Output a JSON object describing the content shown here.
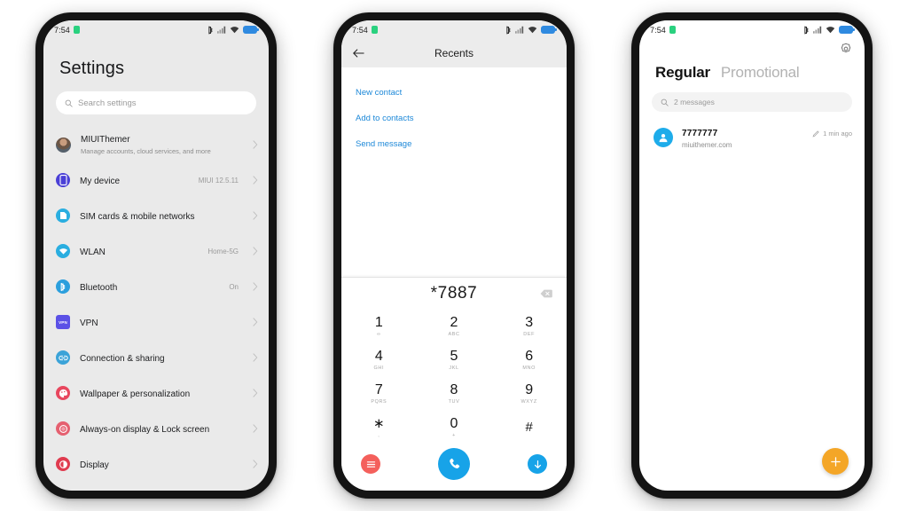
{
  "statusbar": {
    "time": "7:54",
    "icons": [
      "shield-green-icon",
      "bluetooth-icon",
      "signal-icon",
      "wifi-icon",
      "battery-icon"
    ]
  },
  "colors": {
    "accent_blue": "#1d88d8",
    "call_blue": "#17a3e8",
    "red": "#f4605c",
    "orange": "#f4a627",
    "avatar_blue": "#1eacea",
    "settings_bg": "#eaeaea",
    "battery_blue": "#2f8ae0",
    "green": "#2ad17f"
  },
  "settings": {
    "title": "Settings",
    "search_placeholder": "Search settings",
    "items": [
      {
        "label": "MIUIThemer",
        "sub": "Manage accounts, cloud services, and more",
        "value": "",
        "icon": "account-avatar"
      },
      {
        "label": "My device",
        "sub": "",
        "value": "MIUI 12.5.11",
        "icon": "device-icon"
      },
      {
        "label": "SIM cards & mobile networks",
        "sub": "",
        "value": "",
        "icon": "sim-card-icon"
      },
      {
        "label": "WLAN",
        "sub": "",
        "value": "Home-5G",
        "icon": "wifi-icon"
      },
      {
        "label": "Bluetooth",
        "sub": "",
        "value": "On",
        "icon": "bluetooth-icon"
      },
      {
        "label": "VPN",
        "sub": "",
        "value": "",
        "icon": "vpn-icon"
      },
      {
        "label": "Connection & sharing",
        "sub": "",
        "value": "",
        "icon": "link-icon"
      },
      {
        "label": "Wallpaper & personalization",
        "sub": "",
        "value": "",
        "icon": "palette-icon"
      },
      {
        "label": "Always-on display & Lock screen",
        "sub": "",
        "value": "",
        "icon": "aod-icon"
      },
      {
        "label": "Display",
        "sub": "",
        "value": "",
        "icon": "brightness-icon"
      }
    ]
  },
  "dialer": {
    "title": "Recents",
    "back_icon": "back-arrow-icon",
    "actions": [
      "New contact",
      "Add to contacts",
      "Send message"
    ],
    "number": "*7887",
    "backspace_icon": "backspace-icon",
    "keys": [
      {
        "digit": "1",
        "letters": "∞"
      },
      {
        "digit": "2",
        "letters": "ABC"
      },
      {
        "digit": "3",
        "letters": "DEF"
      },
      {
        "digit": "4",
        "letters": "GHI"
      },
      {
        "digit": "5",
        "letters": "JKL"
      },
      {
        "digit": "6",
        "letters": "MNO"
      },
      {
        "digit": "7",
        "letters": "PQRS"
      },
      {
        "digit": "8",
        "letters": "TUV"
      },
      {
        "digit": "9",
        "letters": "WXYZ"
      },
      {
        "digit": "∗",
        "letters": ","
      },
      {
        "digit": "0",
        "letters": "+"
      },
      {
        "digit": "#",
        "letters": ""
      }
    ],
    "bottom": {
      "left_icon": "menu-list-icon",
      "call_icon": "phone-call-icon",
      "right_icon": "arrow-down-icon"
    }
  },
  "messages": {
    "gear_icon": "gear-icon",
    "tab_active": "Regular",
    "tab_inactive": "Promotional",
    "search_placeholder": "2 messages",
    "threads": [
      {
        "name": "7777777",
        "preview": "miuithemer.com",
        "time": "1 min ago",
        "meta_icon": "pencil-icon",
        "avatar_icon": "person-icon"
      }
    ],
    "fab_icon": "plus-icon"
  }
}
